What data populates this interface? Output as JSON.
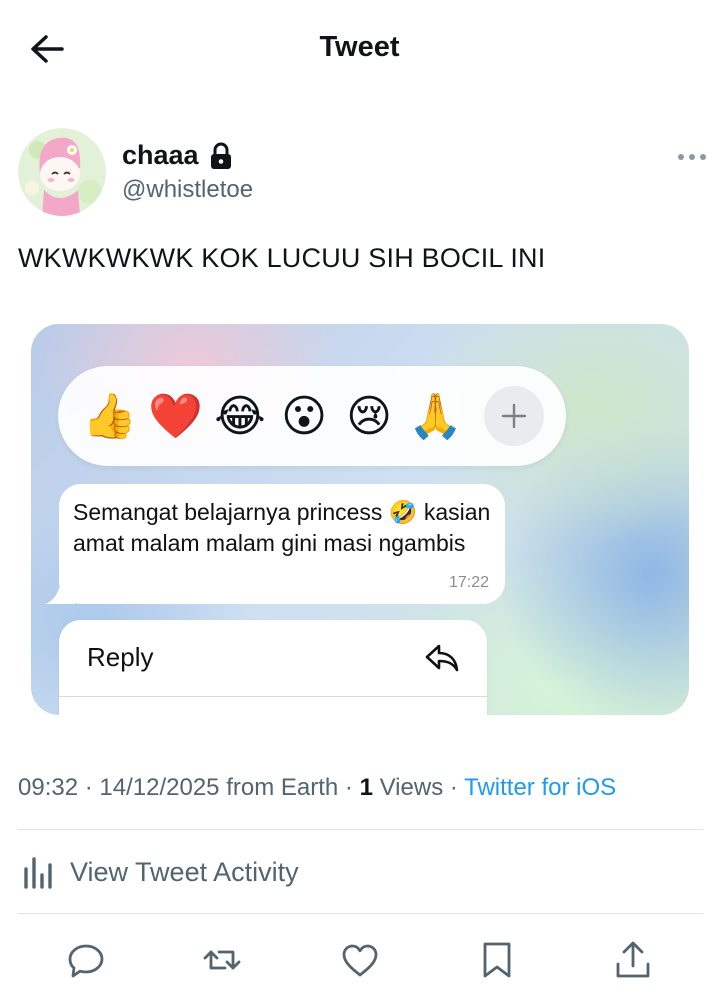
{
  "header": {
    "title": "Tweet",
    "back_icon": "arrow-left-icon"
  },
  "author": {
    "name": "chaaa",
    "handle": "@whistletoe",
    "lock_icon": "lock-icon",
    "more_icon": "more-horizontal-icon"
  },
  "tweet": {
    "text": "WKWKWKWK KOK LUCUU SIH BOCIL INI"
  },
  "media": {
    "reactions": [
      "👍",
      "❤️",
      "😂",
      "😮",
      "😢",
      "🙏"
    ],
    "plus_label": "+",
    "message": {
      "text": "Semangat belajarnya princess 🤣 kasian amat malam malam gini masi ngambis",
      "time": "17:22"
    },
    "menu": {
      "reply_label": "Reply",
      "reply_icon": "reply-arrow-icon"
    }
  },
  "meta": {
    "time": "09:32",
    "date": "14/12/2025 from Earth",
    "sep": "·",
    "views_count": "1",
    "views_label": "Views",
    "source": "Twitter for iOS"
  },
  "activity": {
    "label": "View Tweet Activity",
    "icon": "analytics-bars-icon"
  },
  "actions": [
    "reply-icon",
    "retweet-icon",
    "like-icon",
    "bookmark-icon",
    "share-icon"
  ],
  "colors": {
    "link": "#1d9bf0",
    "secondary_text": "#536471",
    "primary_text": "#0f1419"
  }
}
